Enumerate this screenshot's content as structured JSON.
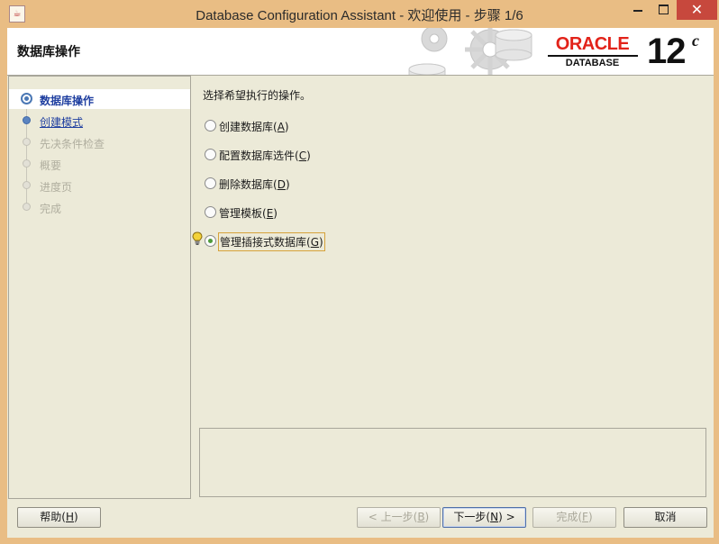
{
  "window": {
    "title": "Database Configuration Assistant - 欢迎使用 - 步骤 1/6",
    "close_glyph": "✕"
  },
  "banner": {
    "title": "数据库操作",
    "logo_word": "ORACLE",
    "logo_sub": "DATABASE",
    "version": "12",
    "version_sup": "c"
  },
  "steps": [
    {
      "label": "数据库操作",
      "state": "active"
    },
    {
      "label": "创建模式",
      "state": "link"
    },
    {
      "label": "先决条件检查",
      "state": "disabled"
    },
    {
      "label": "概要",
      "state": "disabled"
    },
    {
      "label": "进度页",
      "state": "disabled"
    },
    {
      "label": "完成",
      "state": "disabled"
    }
  ],
  "main": {
    "prompt": "选择希望执行的操作。",
    "options": [
      {
        "label": "创建数据库",
        "mnemonic": "A",
        "selected": false
      },
      {
        "label": "配置数据库选件",
        "mnemonic": "C",
        "selected": false
      },
      {
        "label": "删除数据库",
        "mnemonic": "D",
        "selected": false
      },
      {
        "label": "管理模板",
        "mnemonic": "E",
        "selected": false
      },
      {
        "label": "管理插接式数据库",
        "mnemonic": "G",
        "selected": true
      }
    ]
  },
  "buttons": {
    "help": {
      "label": "帮助",
      "mnemonic": "H"
    },
    "back": {
      "prefix": "< 上一步",
      "mnemonic": "B",
      "suffix": ""
    },
    "next": {
      "prefix": "下一步",
      "mnemonic": "N",
      "suffix": " >"
    },
    "finish": {
      "label": "完成",
      "mnemonic": "F"
    },
    "cancel": {
      "label": "取消"
    }
  },
  "colors": {
    "titlebar": "#e9bd84",
    "close_button": "#c7483d",
    "oracle_red": "#e2231a",
    "link_blue": "#1f3fa0",
    "radio_selected": "#4e9a3a"
  },
  "icons": {
    "app": "java-app-icon",
    "hint": "lightbulb-hint-icon",
    "banner_art": "gears-icon"
  }
}
